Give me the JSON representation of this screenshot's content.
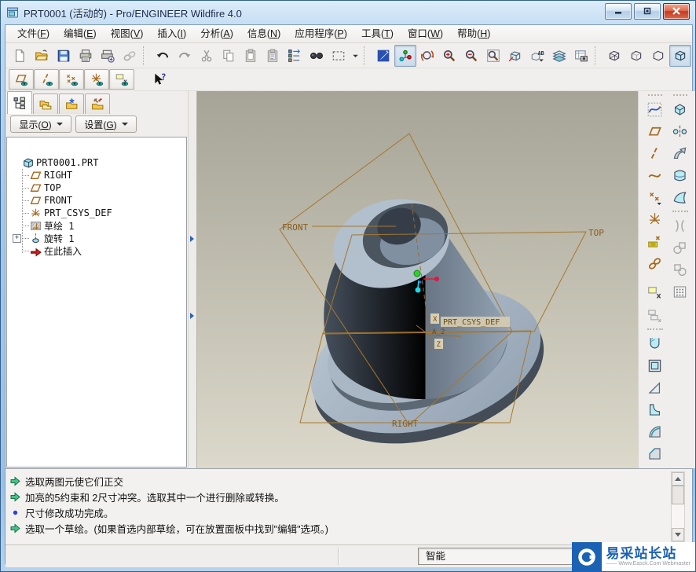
{
  "window": {
    "title": "PRT0001 (活动的) - Pro/ENGINEER Wildfire 4.0"
  },
  "menubar": {
    "items": [
      "文件(F)",
      "编辑(E)",
      "视图(V)",
      "插入(I)",
      "分析(A)",
      "信息(N)",
      "应用程序(P)",
      "工具(T)",
      "窗口(W)",
      "帮助(H)"
    ]
  },
  "toolbar_main": {
    "items": [
      {
        "n": "new-file"
      },
      {
        "n": "open-file"
      },
      {
        "n": "save-file"
      },
      {
        "n": "print"
      },
      {
        "n": "print-setup"
      },
      {
        "n": "link",
        "disabled": true
      },
      {
        "sep": true
      },
      {
        "n": "undo"
      },
      {
        "n": "redo",
        "disabled": true
      },
      {
        "n": "cut",
        "disabled": true
      },
      {
        "n": "copy",
        "disabled": true
      },
      {
        "n": "paste",
        "disabled": true
      },
      {
        "n": "paste-special",
        "disabled": true
      },
      {
        "n": "model-tree-settings"
      },
      {
        "n": "find"
      },
      {
        "n": "selection-box"
      },
      {
        "n": "caret",
        "narrow": true
      },
      {
        "sep": true
      },
      {
        "n": "redraw"
      },
      {
        "n": "spin-center",
        "pressed": true
      },
      {
        "n": "orient-mode"
      },
      {
        "n": "zoom-in"
      },
      {
        "n": "zoom-out"
      },
      {
        "n": "refit"
      },
      {
        "n": "saved-views"
      },
      {
        "n": "named-views"
      },
      {
        "n": "layers"
      },
      {
        "n": "view-manager"
      },
      {
        "sep": true
      },
      {
        "n": "wireframe"
      },
      {
        "n": "hidden-line"
      },
      {
        "n": "no-hidden"
      },
      {
        "n": "shaded",
        "pressed": true
      }
    ]
  },
  "toolbar_datum": {
    "items": [
      {
        "n": "plane-display",
        "latched": true
      },
      {
        "n": "axis-display",
        "latched": true
      },
      {
        "n": "point-display",
        "latched": true
      },
      {
        "n": "csys-display",
        "latched": true
      },
      {
        "n": "annotation-display",
        "latched": true
      },
      {
        "gap": 16
      },
      {
        "n": "context-help"
      }
    ]
  },
  "left_panel": {
    "tabs": [
      {
        "name": "model-tree-tab",
        "active": true
      },
      {
        "name": "folder-browser-tab"
      },
      {
        "name": "favorites-tab"
      },
      {
        "name": "connections-tab"
      }
    ],
    "buttons": [
      {
        "label": "显示(O)"
      },
      {
        "label": "设置(G)"
      }
    ]
  },
  "model_tree": {
    "items": [
      {
        "icon": "part",
        "label": "PRT0001.PRT"
      },
      {
        "icon": "datum-plane",
        "label": "RIGHT",
        "child": true
      },
      {
        "icon": "datum-plane",
        "label": "TOP",
        "child": true
      },
      {
        "icon": "datum-plane",
        "label": "FRONT",
        "child": true
      },
      {
        "icon": "csys",
        "label": "PRT_CSYS_DEF",
        "child": true
      },
      {
        "icon": "sketch",
        "label": "草绘 1",
        "child": true
      },
      {
        "icon": "revolve",
        "label": "旋转 1",
        "child": true,
        "expandable": true
      },
      {
        "icon": "insert-here",
        "label": "在此插入",
        "child": true
      }
    ]
  },
  "graphics": {
    "labels": {
      "front": "FRONT",
      "top": "TOP",
      "right": "RIGHT",
      "csys": "PRT_CSYS_DEF",
      "axis": "A_2",
      "x": "X",
      "z": "Z"
    }
  },
  "right_toolbar": {
    "col1": [
      {
        "n": "sketch-tool"
      },
      {
        "n": "datum-plane-tool"
      },
      {
        "n": "datum-axis-tool"
      },
      {
        "n": "datum-curve-tool"
      },
      {
        "n": "datum-point-tool"
      },
      {
        "n": "datum-csys-tool"
      },
      {
        "n": "dimension-tool"
      },
      {
        "n": "link-tool"
      },
      {
        "gap": 10
      },
      {
        "n": "annotation-tool"
      },
      {
        "n": "annotation-tool-alt",
        "disabled": true
      },
      {
        "sep": true
      },
      {
        "n": "hole-tool"
      },
      {
        "n": "shell-tool"
      },
      {
        "n": "draft-tool"
      },
      {
        "n": "rib-tool"
      },
      {
        "n": "round-tool"
      },
      {
        "n": "chamfer-tool"
      }
    ],
    "col2": [
      {
        "n": "extrude-tool"
      },
      {
        "n": "revolve-tool"
      },
      {
        "n": "sweep-tool"
      },
      {
        "n": "boundary-blend-tool"
      },
      {
        "n": "style-tool"
      },
      {
        "sep": true
      },
      {
        "n": "pipe-tool",
        "disabled": true
      },
      {
        "n": "merge-tool",
        "disabled": true
      },
      {
        "n": "trim-tool",
        "disabled": true
      },
      {
        "n": "pattern-tool",
        "disabled": true
      }
    ]
  },
  "messages": {
    "items": [
      {
        "icon": "green-arrow",
        "text": "选取两图元使它们正交"
      },
      {
        "icon": "green-arrow",
        "text": "加亮的5约束和 2尺寸冲突。选取其中一个进行删除或转换。"
      },
      {
        "icon": "blue-dot",
        "text": "尺寸修改成功完成。"
      },
      {
        "icon": "green-arrow",
        "text": "选取一个草绘。(如果首选内部草绘，可在放置面板中找到\"编辑\"选项。)"
      }
    ]
  },
  "statusbar": {
    "selection_filter": "智能"
  },
  "watermark": {
    "brand": "易采站长站",
    "caption": "—— Www.Easck.Com Webmaster"
  },
  "colors": {
    "datum_brown": "#a5772f",
    "part_light": "#b2bfcc",
    "part_dark": "#46515e",
    "gfx_bg_top": "#a6a496",
    "gfx_bg_bottom": "#dcd9cb",
    "frame_blue": "#a5c6e7",
    "watermark_blue": "#1b62b4"
  }
}
